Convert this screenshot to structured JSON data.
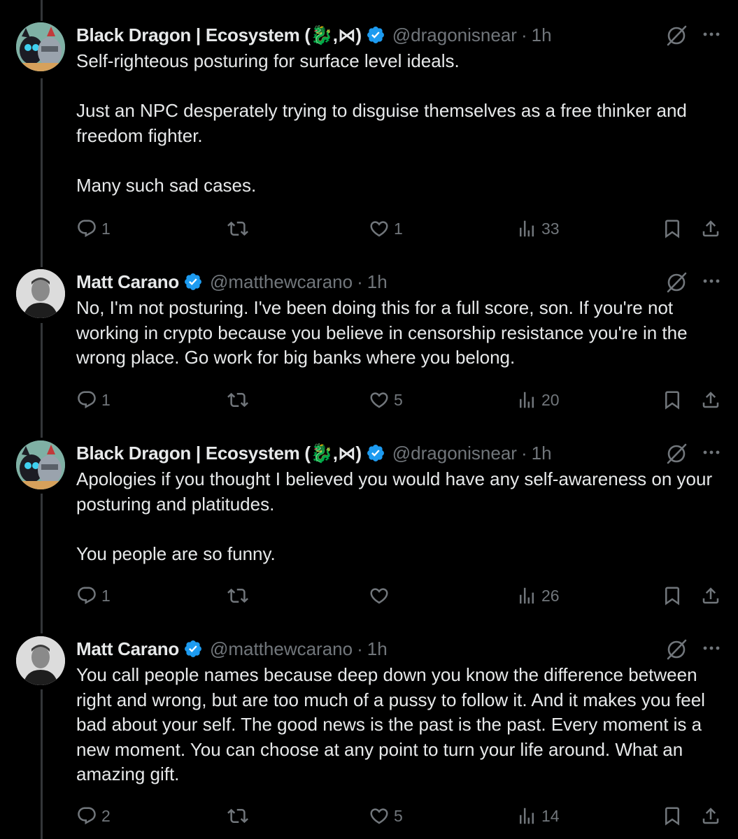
{
  "tweets": [
    {
      "name": "Black Dragon | Ecosystem (🐉,⋈)",
      "handle": "@dragonisnear",
      "time": "1h",
      "paragraphs": [
        "Self-righteous posturing for surface level ideals.",
        "Just an NPC desperately trying to disguise themselves as a free thinker and freedom fighter.",
        "Many such sad cases."
      ],
      "replies": "1",
      "reposts": "",
      "likes": "1",
      "views": "33"
    },
    {
      "name": "Matt Carano",
      "handle": "@matthewcarano",
      "time": "1h",
      "paragraphs": [
        "No, I'm not posturing. I've been doing this for a full score, son. If you're not working in crypto because you believe in censorship resistance you're in the wrong place. Go work for big banks where you belong."
      ],
      "replies": "1",
      "reposts": "",
      "likes": "5",
      "views": "20"
    },
    {
      "name": "Black Dragon | Ecosystem (🐉,⋈)",
      "handle": "@dragonisnear",
      "time": "1h",
      "paragraphs": [
        "Apologies if you thought I believed you would have any self-awareness on your posturing and platitudes.",
        "You people are so funny."
      ],
      "replies": "1",
      "reposts": "",
      "likes": "",
      "views": "26"
    },
    {
      "name": "Matt Carano",
      "handle": "@matthewcarano",
      "time": "1h",
      "paragraphs": [
        "You call people names because deep down you know the difference between right and wrong, but are too much of a pussy to follow it. And it makes you feel bad about your self. The good news is the past is the past. Every moment is a new moment. You can choose at any point to turn your life around. What an amazing gift."
      ],
      "replies": "2",
      "reposts": "",
      "likes": "5",
      "views": "14"
    }
  ],
  "separator": "·",
  "colors": {
    "background": "#000000",
    "text": "#e7e9ea",
    "muted": "#71767b",
    "verified": "#1d9bf0",
    "thread_line": "#333639"
  },
  "icons": [
    "reply-icon",
    "repost-icon",
    "like-icon",
    "views-icon",
    "bookmark-icon",
    "share-icon",
    "grok-icon",
    "more-icon",
    "verified-badge-icon"
  ]
}
